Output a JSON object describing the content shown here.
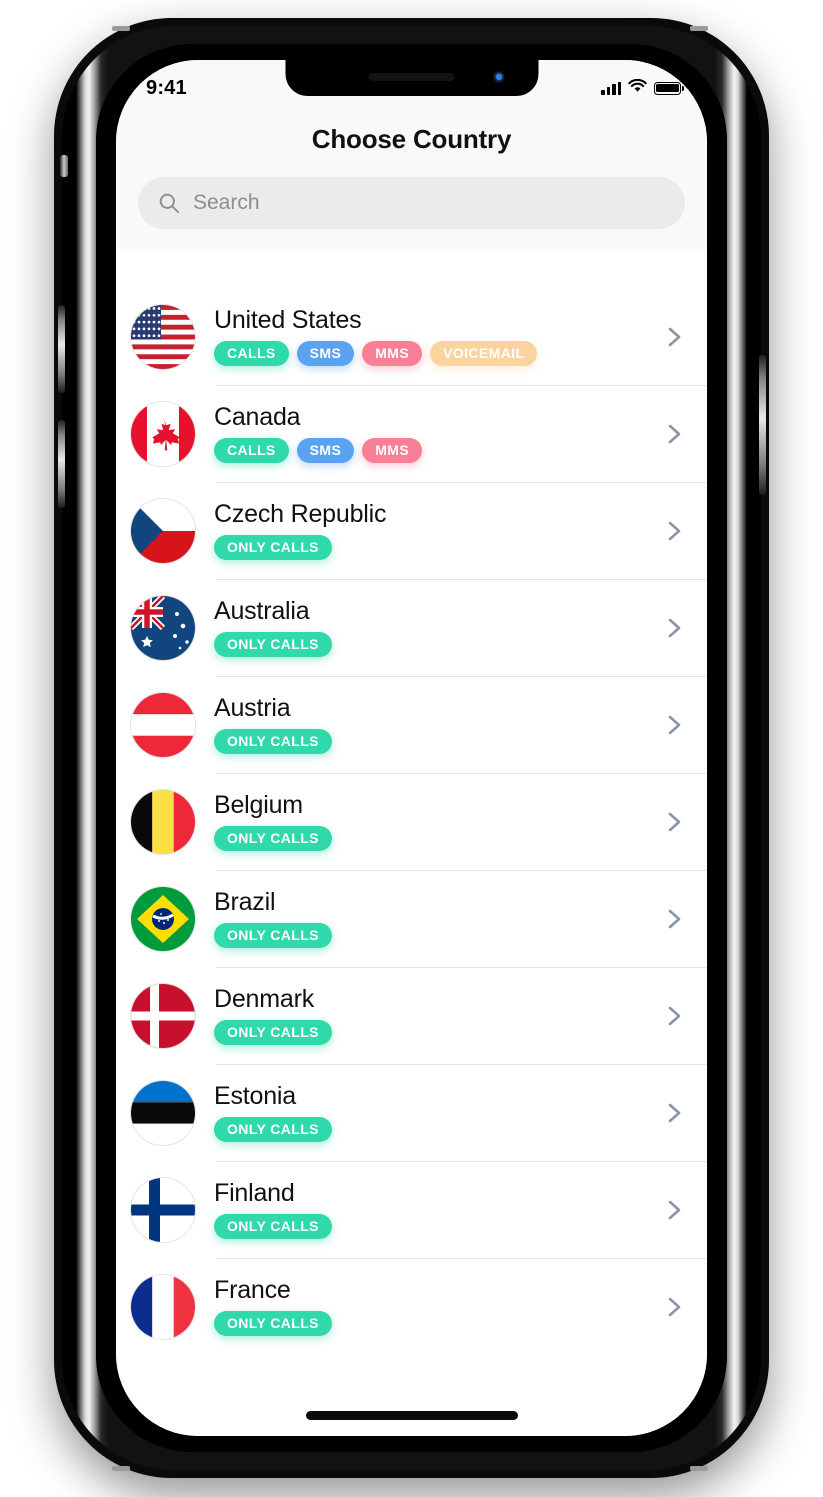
{
  "status_bar": {
    "time": "9:41",
    "cellular_icon": "cellular-bars-icon",
    "wifi_icon": "wifi-icon",
    "battery_icon": "battery-full-icon"
  },
  "header": {
    "title": "Choose Country"
  },
  "search": {
    "icon": "search-icon",
    "placeholder": "Search",
    "value": ""
  },
  "colors": {
    "calls": "#2FD9A9",
    "sms": "#5BA3F0",
    "mms": "#F97F95",
    "voicemail": "#FAD3A0",
    "chevron": "#8B95A8",
    "header_bg": "#F9F9F9",
    "search_bg": "#EBEBEB",
    "separator": "#E4E4E4",
    "text": "#111111"
  },
  "badge_labels": {
    "calls": "CALLS",
    "sms": "SMS",
    "mms": "MMS",
    "voicemail": "VOICEMAIL",
    "only_calls": "ONLY CALLS"
  },
  "countries": [
    {
      "name": "United States",
      "flag": "us",
      "badges": [
        "CALLS",
        "SMS",
        "MMS",
        "VOICEMAIL"
      ]
    },
    {
      "name": "Canada",
      "flag": "ca",
      "badges": [
        "CALLS",
        "SMS",
        "MMS"
      ]
    },
    {
      "name": "Czech Republic",
      "flag": "cz",
      "badges": [
        "ONLY CALLS"
      ]
    },
    {
      "name": "Australia",
      "flag": "au",
      "badges": [
        "ONLY CALLS"
      ]
    },
    {
      "name": "Austria",
      "flag": "at",
      "badges": [
        "ONLY CALLS"
      ]
    },
    {
      "name": "Belgium",
      "flag": "be",
      "badges": [
        "ONLY CALLS"
      ]
    },
    {
      "name": "Brazil",
      "flag": "br",
      "badges": [
        "ONLY CALLS"
      ]
    },
    {
      "name": "Denmark",
      "flag": "dk",
      "badges": [
        "ONLY CALLS"
      ]
    },
    {
      "name": "Estonia",
      "flag": "ee",
      "badges": [
        "ONLY CALLS"
      ]
    },
    {
      "name": "Finland",
      "flag": "fi",
      "badges": [
        "ONLY CALLS"
      ]
    },
    {
      "name": "France",
      "flag": "fr",
      "badges": [
        "ONLY CALLS"
      ]
    }
  ],
  "row_chevron_icon": "chevron-right-icon",
  "home_indicator": "home-indicator"
}
